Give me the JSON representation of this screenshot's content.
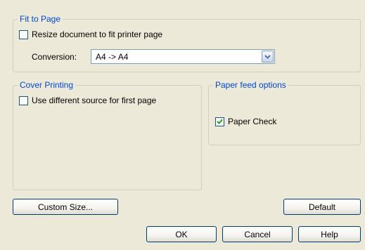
{
  "fit_to_page": {
    "title": "Fit to Page",
    "resize_checkbox": {
      "label": "Resize document to fit printer page",
      "checked": false
    },
    "conversion_label": "Conversion:",
    "conversion_value": "A4 -> A4"
  },
  "cover_printing": {
    "title": "Cover Printing",
    "different_source_checkbox": {
      "label": "Use different source for first page",
      "checked": false
    }
  },
  "paper_feed": {
    "title": "Paper feed options",
    "paper_check_checkbox": {
      "label": "Paper Check",
      "checked": true
    }
  },
  "buttons": {
    "custom_size": "Custom Size...",
    "default": "Default",
    "ok": "OK",
    "cancel": "Cancel",
    "help": "Help"
  },
  "colors": {
    "group_title": "#0046d5",
    "checkmark": "#21a121",
    "background": "#ece9d8"
  }
}
